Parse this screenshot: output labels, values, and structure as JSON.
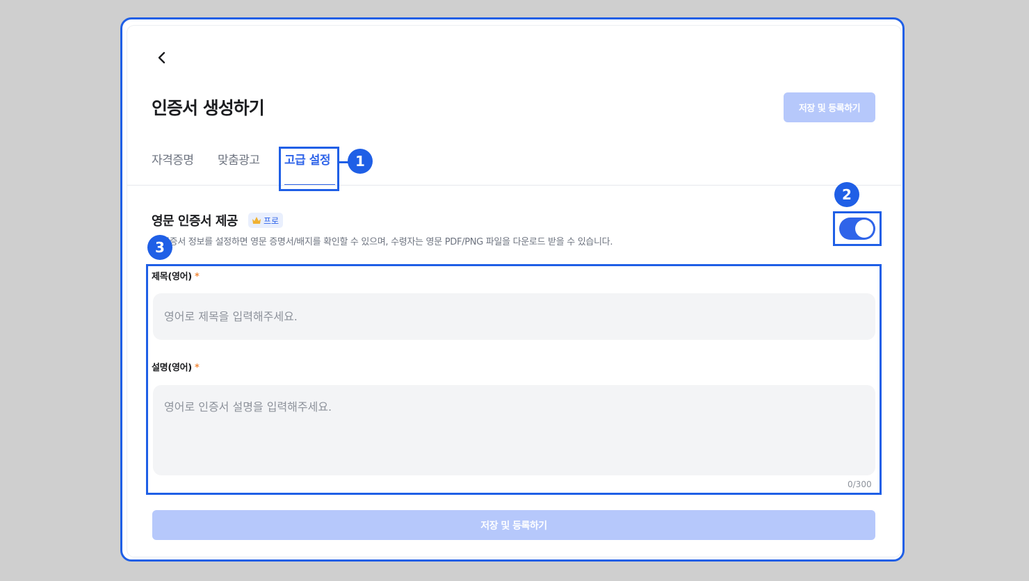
{
  "header": {
    "title": "인증서 생성하기",
    "save_label": "저장 및 등록하기"
  },
  "tabs": [
    {
      "label": "자격증명",
      "active": false
    },
    {
      "label": "맞춤광고",
      "active": false
    },
    {
      "label": "고급 설정",
      "active": true
    }
  ],
  "section": {
    "title": "영문 인증서 제공",
    "badge": "프로",
    "description": "인증서 정보를 설정하면 영문 증명서/배지를 확인할 수 있으며, 수령자는 영문 PDF/PNG 파일을 다운로드 받을 수 있습니다.",
    "toggle_on": true
  },
  "fields": {
    "title_label": "제목(영어)",
    "title_placeholder": "영어로 제목을 입력해주세요.",
    "desc_label": "설명(영어)",
    "desc_placeholder": "영어로 인증서 설명을 입력해주세요.",
    "required_mark": "*",
    "counter": "0/300"
  },
  "footer": {
    "save_label": "저장 및 등록하기"
  },
  "annotations": [
    "1",
    "2",
    "3"
  ],
  "colors": {
    "accent": "#2f64e9",
    "annotation": "#1f5fe6",
    "disabled_button": "#b6c8fb"
  }
}
